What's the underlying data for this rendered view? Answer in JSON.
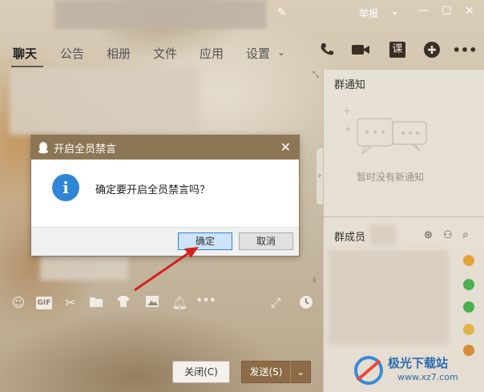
{
  "titlebar": {
    "report_label": "举报",
    "icons": [
      "edit-icon",
      "chevron-down-icon",
      "minimize-icon",
      "maximize-icon",
      "close-icon"
    ]
  },
  "tabs": [
    {
      "label": "聊天",
      "active": true
    },
    {
      "label": "公告"
    },
    {
      "label": "相册"
    },
    {
      "label": "文件"
    },
    {
      "label": "应用"
    },
    {
      "label": "设置"
    }
  ],
  "toolbar_icons": [
    "phone-icon",
    "video-icon",
    "class-icon",
    "add-app-icon",
    "more-icon"
  ],
  "class_icon_label": "课",
  "right_pane": {
    "notice_title": "群通知",
    "notice_empty": "暂时没有新通知",
    "members_title": "群成员"
  },
  "chat_toolbar": {
    "gif_label": "GIF",
    "more_label": "•••"
  },
  "buttons": {
    "close_label": "关闭(C)",
    "send_label": "发送(S)"
  },
  "dialog": {
    "title": "开启全员禁言",
    "message": "确定要开启全员禁言吗？",
    "ok_label": "确定",
    "cancel_label": "取消",
    "info_glyph": "i"
  },
  "watermark": {
    "text": "极光下载站",
    "url": "www.xz7.com"
  },
  "colors": {
    "accent": "#8c6b46",
    "dialog_header": "#8d7656",
    "info_blue": "#2f86d6",
    "arrow_red": "#d42020"
  }
}
